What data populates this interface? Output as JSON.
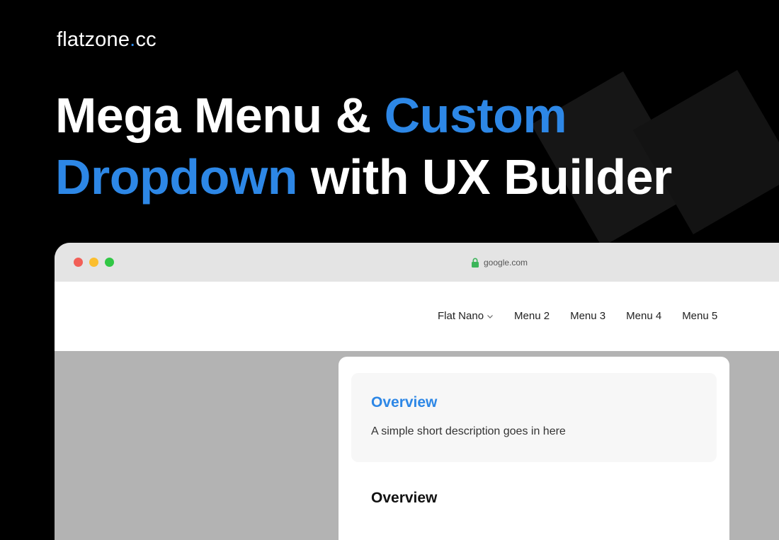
{
  "brand": {
    "name_part1": "flatzone",
    "dot": ".",
    "name_part2": "cc"
  },
  "headline": {
    "line1_white": "Mega Menu & ",
    "line1_blue": "Custom",
    "line2_blue": "Dropdown",
    "line2_white": " with UX Builder"
  },
  "browser": {
    "address": "google.com",
    "icons": {
      "lock": "lock-icon",
      "chevron": "chevron-down-icon"
    }
  },
  "nav": {
    "items": [
      {
        "label": "Flat Nano",
        "has_dropdown": true
      },
      {
        "label": "Menu 2"
      },
      {
        "label": "Menu 3"
      },
      {
        "label": "Menu 4"
      },
      {
        "label": "Menu 5"
      }
    ]
  },
  "dropdown": {
    "card_title": "Overview",
    "card_description": "A simple short description goes in here",
    "section_title": "Overview"
  },
  "colors": {
    "accent": "#2d87e6",
    "background": "#000000",
    "traffic_red": "#f25f57",
    "traffic_yellow": "#fbbe2e",
    "traffic_green": "#31c745",
    "lock_green": "#3cb55a"
  }
}
